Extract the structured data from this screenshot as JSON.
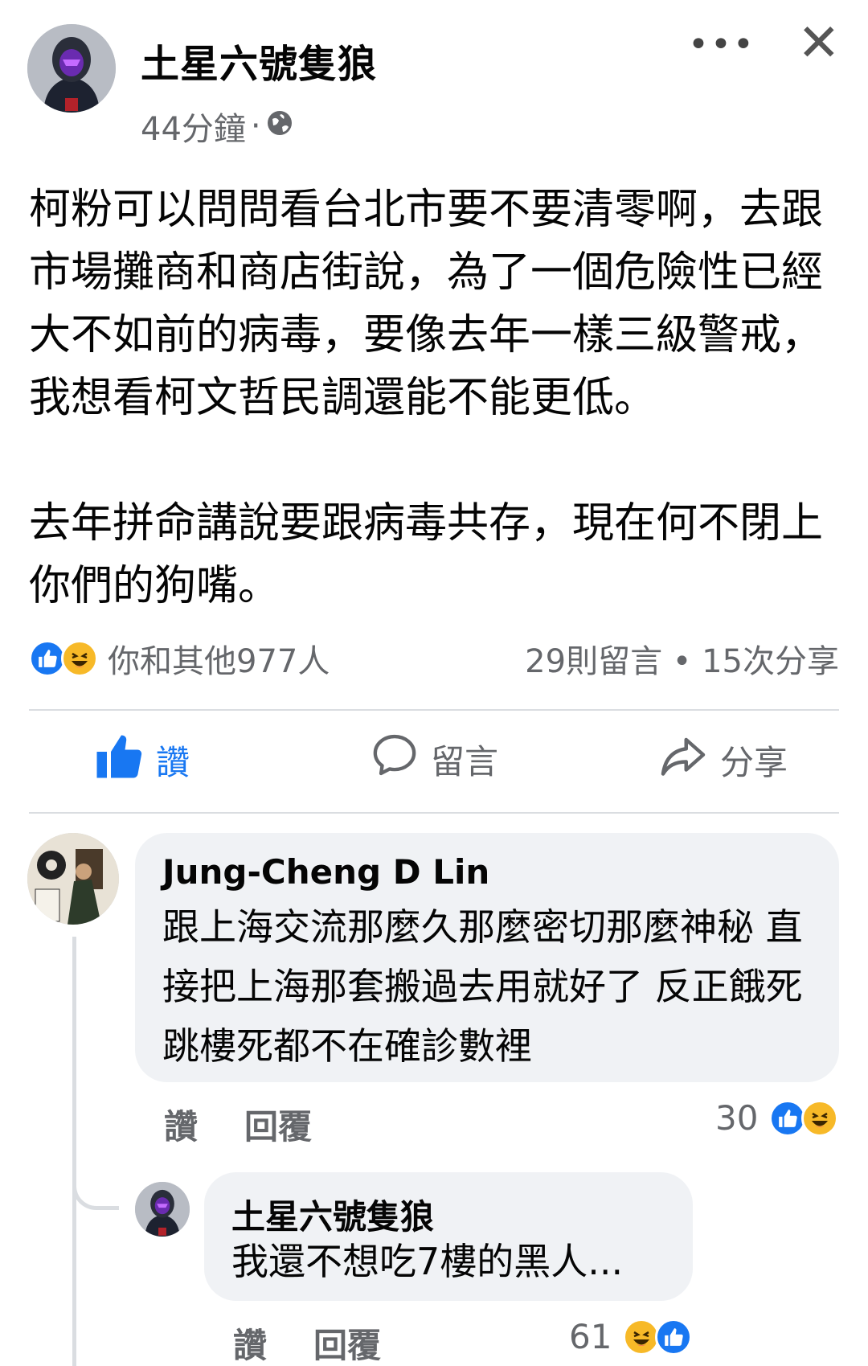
{
  "post": {
    "author": "土星六號隻狼",
    "time": "44分鐘",
    "separator": "·",
    "paragraphs": [
      "柯粉可以問問看台北市要不要清零啊，去跟市場攤商和商店街說，為了一個危險性已經大不如前的病毒，要像去年一樣三級警戒，我想看柯文哲民調還能不能更低。",
      "去年拼命講說要跟病毒共存，現在何不閉上你們的狗嘴。"
    ],
    "reactions_text": "你和其他977人",
    "comments_shares": "29則留言 • 15次分享",
    "actions": {
      "like": "讚",
      "comment": "留言",
      "share": "分享"
    }
  },
  "comments": [
    {
      "name": "Jung-Cheng D Lin",
      "text": "跟上海交流那麼久那麼密切那麼神秘 直接把上海那套搬過去用就好了 反正餓死跳樓死都不在確診數裡",
      "like_label": "讚",
      "reply_label": "回覆",
      "reaction_count": "30"
    },
    {
      "name": "土星六號隻狼",
      "text": "我還不想吃7樓的黑人...",
      "like_label": "讚",
      "reply_label": "回覆",
      "reaction_count": "61"
    }
  ],
  "icons": {
    "more": "more-dots-icon",
    "close": "close-icon",
    "globe": "globe-icon",
    "like": "thumbs-up-icon",
    "comment": "speech-bubble-icon",
    "share": "share-arrow-icon",
    "reaction_like": "like-reaction-icon",
    "reaction_haha": "haha-reaction-icon"
  },
  "colors": {
    "accent": "#1877f2",
    "muted": "#65676b",
    "bubble": "#f0f2f5",
    "haha": "#f7b928"
  }
}
